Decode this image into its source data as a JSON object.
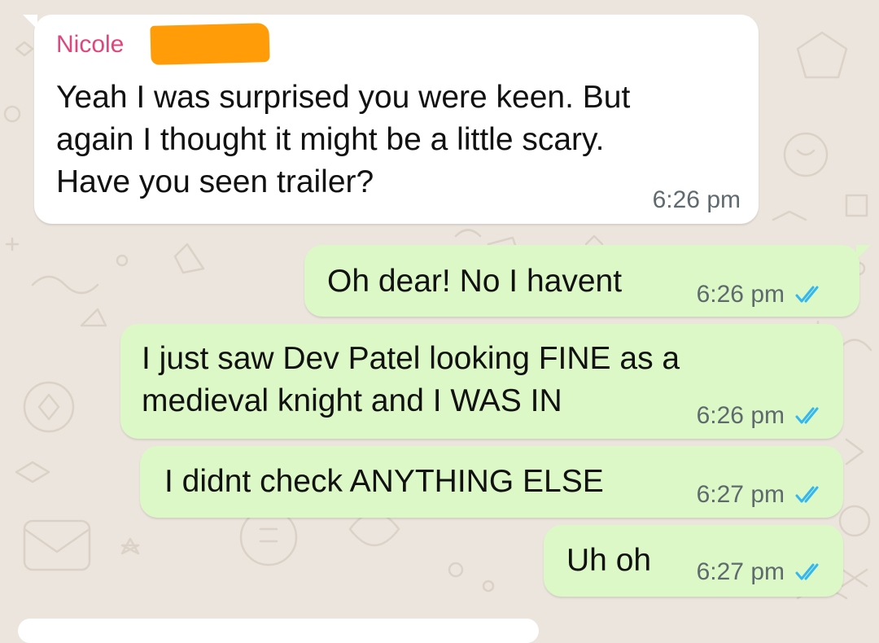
{
  "colors": {
    "background": "#ECE5DD",
    "incoming_bubble": "#FFFFFF",
    "outgoing_bubble": "#DCF8C6",
    "sender_name": "#E0457B",
    "redaction": "#FF9C07",
    "read_ticks": "#34B7F1"
  },
  "conversation": {
    "messages": [
      {
        "direction": "incoming",
        "sender": "Nicole",
        "sender_name_redacted": true,
        "text": "Yeah I was surprised you were keen. But\nagain I thought it might be a little scary.\nHave you seen trailer?",
        "time": "6:26 pm"
      },
      {
        "direction": "outgoing",
        "text": "Oh dear! No I havent",
        "time": "6:26 pm",
        "status_icon": "double-check-read-icon"
      },
      {
        "direction": "outgoing",
        "text": "I just saw Dev Patel looking FINE as a\nmedieval knight and I WAS IN",
        "time": "6:26 pm",
        "status_icon": "double-check-read-icon"
      },
      {
        "direction": "outgoing",
        "text": "I didnt check ANYTHING ELSE",
        "time": "6:27 pm",
        "status_icon": "double-check-read-icon"
      },
      {
        "direction": "outgoing",
        "text": "Uh oh",
        "time": "6:27 pm",
        "status_icon": "double-check-read-icon"
      }
    ]
  }
}
